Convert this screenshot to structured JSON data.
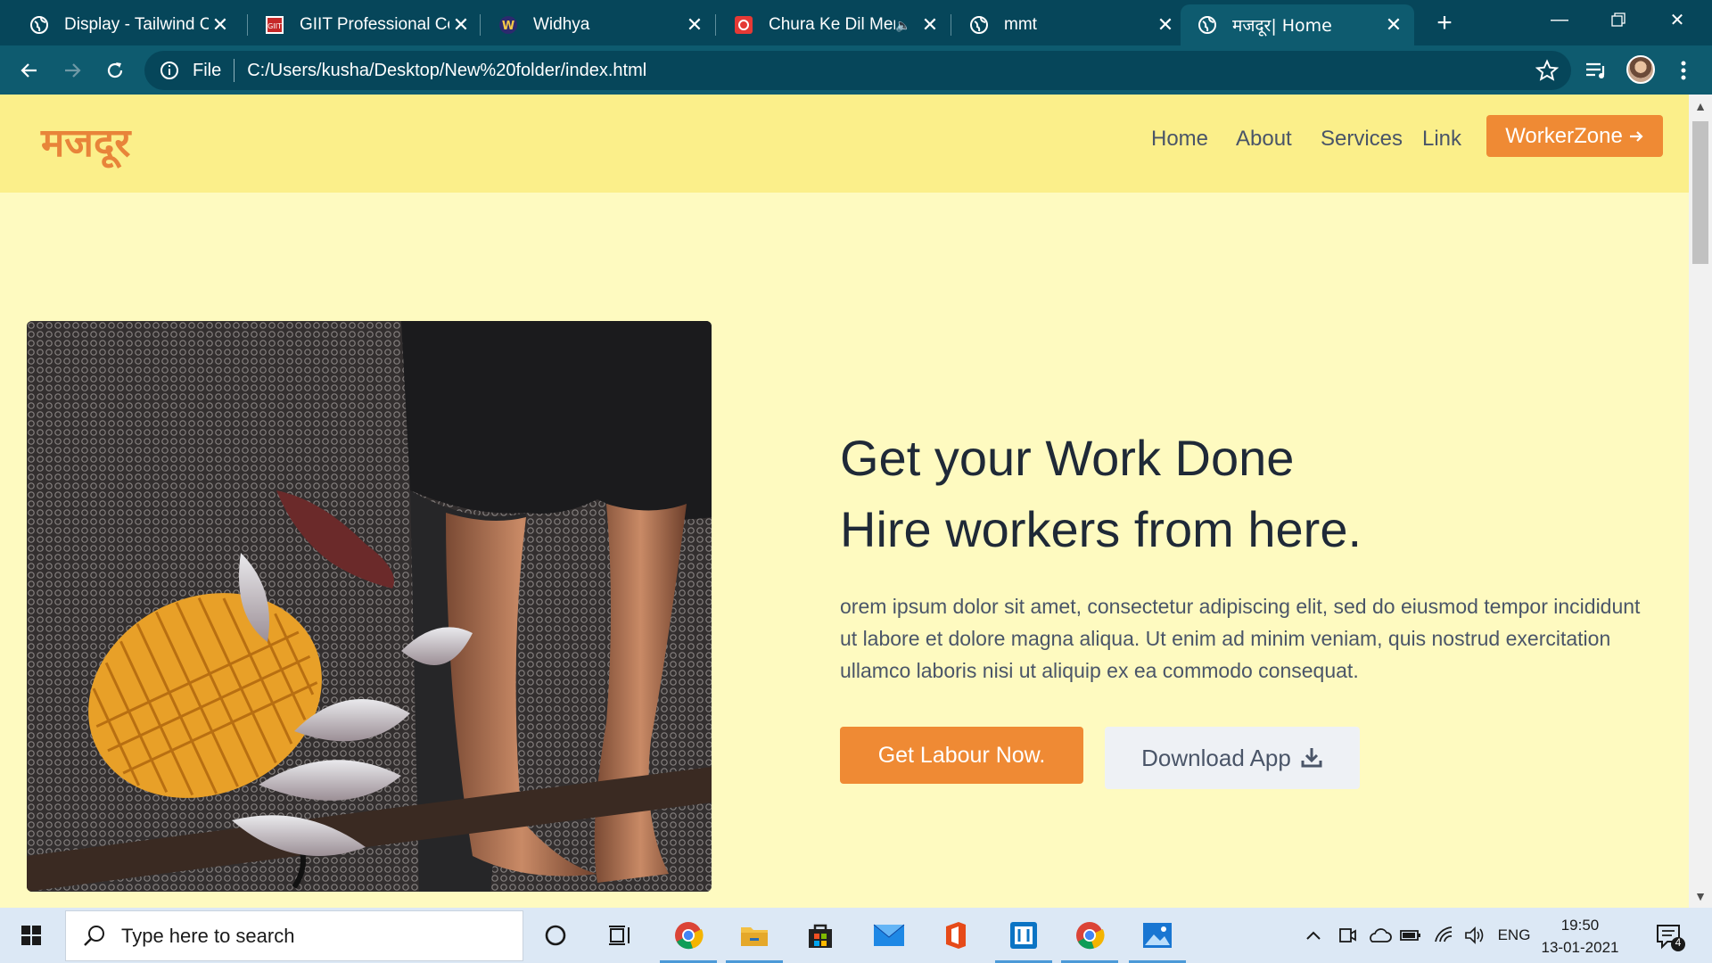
{
  "browser": {
    "tabs": [
      {
        "title": "Display - Tailwind CSS",
        "icon": "globe-icon"
      },
      {
        "title": "GIIT Professional College",
        "icon": "giit-logo-icon"
      },
      {
        "title": "Widhya",
        "icon": "widhya-logo-icon"
      },
      {
        "title": "Chura Ke Dil Mera",
        "icon": "music-app-icon"
      },
      {
        "title": "mmt",
        "icon": "globe-icon"
      },
      {
        "title": "मजदूर| Home",
        "icon": "globe-icon"
      }
    ],
    "active_tab_index": 5,
    "scheme_label": "File",
    "url": "C:/Users/kusha/Desktop/New%20folder/index.html",
    "colors": {
      "tabbar": "#06465a",
      "toolbar": "#0e5b6f"
    }
  },
  "page": {
    "brand": "मजदूर",
    "nav": [
      "Home",
      "About",
      "Services",
      "Link"
    ],
    "nav_cta": "WorkerZone",
    "headline_line1": "Get your Work Done",
    "headline_line2": "Hire workers from here.",
    "paragraph": "orem ipsum dolor sit amet, consectetur adipiscing elit, sed do eiusmod tempor incididunt ut labore et dolore magna aliqua. Ut enim ad minim veniam, quis nostrud exercitation ullamco laboris nisi ut aliquip ex ea commodo consequat.",
    "primary_button": "Get Labour Now.",
    "secondary_button": "Download App",
    "colors": {
      "navbar": "#fbef8a",
      "background": "#fefac0",
      "accent": "#ef8a34",
      "heading": "#1f2937"
    }
  },
  "taskbar": {
    "search_placeholder": "Type here to search",
    "apps": [
      "cortana-icon",
      "task-view-icon",
      "chrome-icon",
      "file-explorer-icon",
      "store-icon",
      "mail-icon",
      "office-icon",
      "app-icon",
      "chrome-icon",
      "photos-icon"
    ],
    "language": "ENG",
    "time": "19:50",
    "date": "13-01-2021",
    "notifications": "4"
  }
}
